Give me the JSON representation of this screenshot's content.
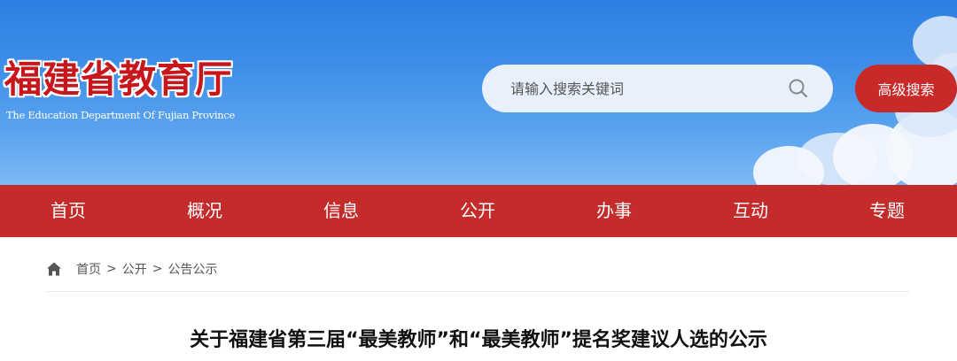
{
  "header": {
    "logo_cn": "福建省教育厅",
    "logo_en": "The Education Department Of Fujian Province",
    "search": {
      "placeholder": "请输入搜索关键词",
      "value": ""
    },
    "advanced_search_label": "高级搜索",
    "icons": {
      "search": "search-icon"
    }
  },
  "nav": {
    "items": [
      {
        "label": "首页"
      },
      {
        "label": "概况"
      },
      {
        "label": "信息"
      },
      {
        "label": "公开"
      },
      {
        "label": "办事"
      },
      {
        "label": "互动"
      },
      {
        "label": "专题"
      }
    ]
  },
  "breadcrumb": {
    "icon": "home-icon",
    "items": [
      "首页",
      "公开",
      "公告公示"
    ],
    "separator": ">"
  },
  "article": {
    "title": "关于福建省第三届“最美教师”和“最美教师”提名奖建议人选的公示"
  },
  "colors": {
    "brand_red": "#c42b2b",
    "banner_blue": "#3d8ee8",
    "logo_red": "#c8161d"
  }
}
